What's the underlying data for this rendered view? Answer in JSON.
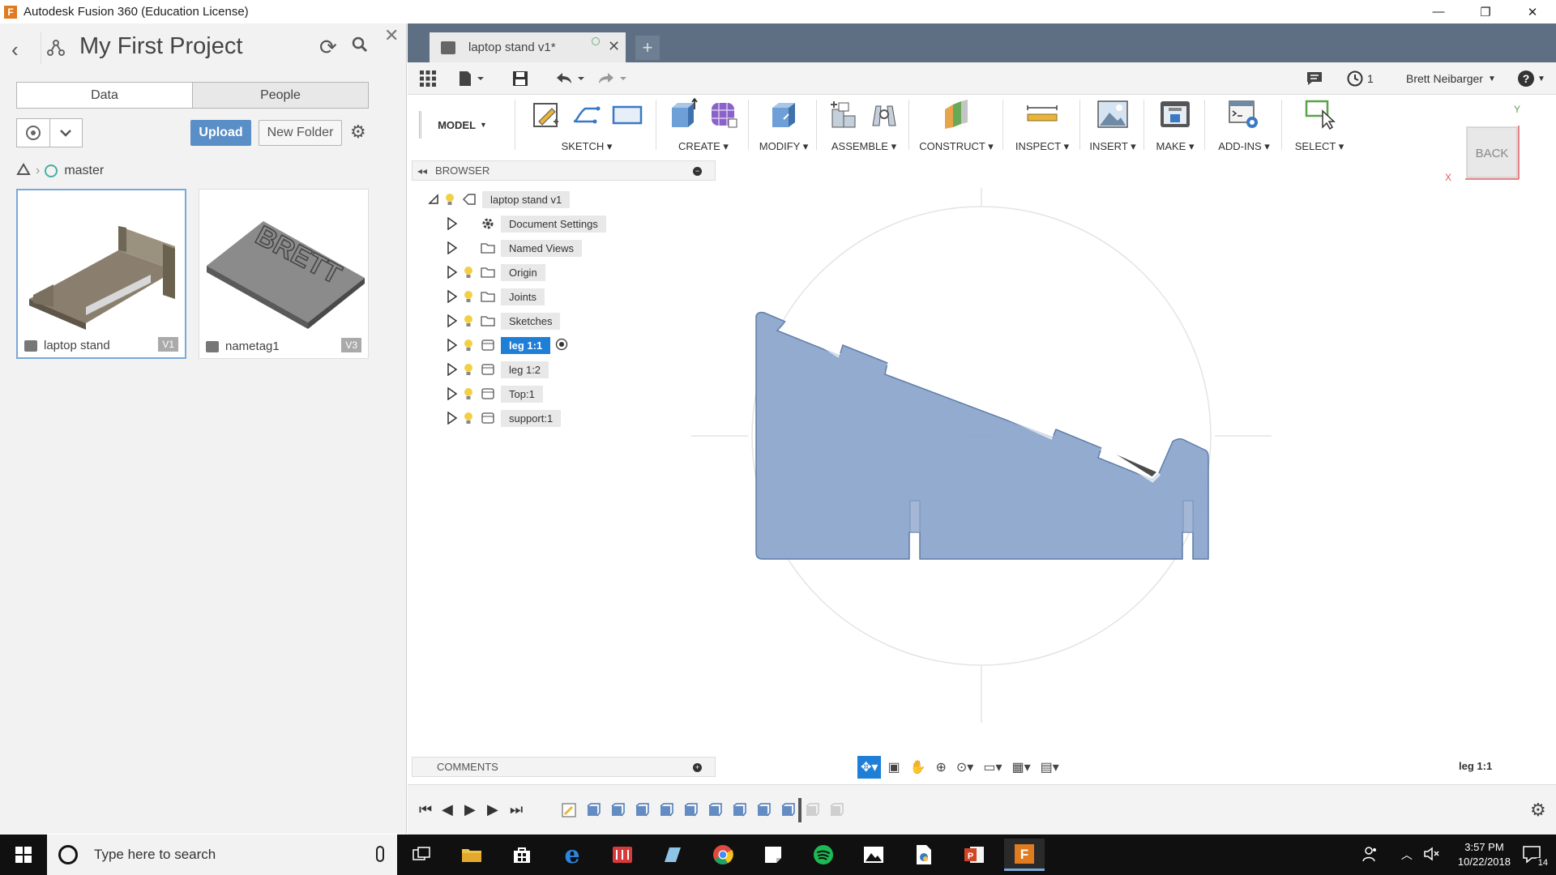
{
  "window": {
    "title": "Autodesk Fusion 360 (Education License)",
    "app_icon_letter": "F",
    "controls": [
      "—",
      "❐",
      "✕"
    ]
  },
  "data_panel": {
    "project_title": "My First Project",
    "tabs": [
      "Data",
      "People"
    ],
    "upload_label": "Upload",
    "new_folder_label": "New Folder",
    "branch": "master",
    "files": [
      {
        "name": "laptop stand",
        "version": "V1"
      },
      {
        "name": "nametag1",
        "version": "V3"
      }
    ],
    "nametag_text": "BRETT"
  },
  "document": {
    "tab_name": "laptop stand v1*",
    "new_tab_symbol": "+"
  },
  "appbar": {
    "job_count": "1",
    "user_name": "Brett Neibarger",
    "help_symbol": "?"
  },
  "toolbar": {
    "workspace": "MODEL",
    "groups": [
      "SKETCH",
      "CREATE",
      "MODIFY",
      "ASSEMBLE",
      "CONSTRUCT",
      "INSPECT",
      "INSERT",
      "MAKE",
      "ADD-INS",
      "SELECT"
    ]
  },
  "browser": {
    "title": "BROWSER",
    "root": "laptop stand v1",
    "items": [
      "Document Settings",
      "Named Views",
      "Origin",
      "Joints",
      "Sketches",
      "leg 1:1",
      "leg 1:2",
      "Top:1",
      "support:1"
    ]
  },
  "viewcube": {
    "face_label": "BACK",
    "axis_x": "X",
    "axis_y": "Y"
  },
  "comments": {
    "title": "COMMENTS"
  },
  "status": {
    "selection": "leg 1:1"
  },
  "taskbar": {
    "search_placeholder": "Type here to search",
    "time": "3:57 PM",
    "date": "10/22/2018",
    "notification_count": "14"
  },
  "colors": {
    "accent": "#1f7fd6",
    "part_fill": "#8da6cc",
    "doc_bar": "#5e6f83",
    "upload": "#5a8ec6"
  }
}
